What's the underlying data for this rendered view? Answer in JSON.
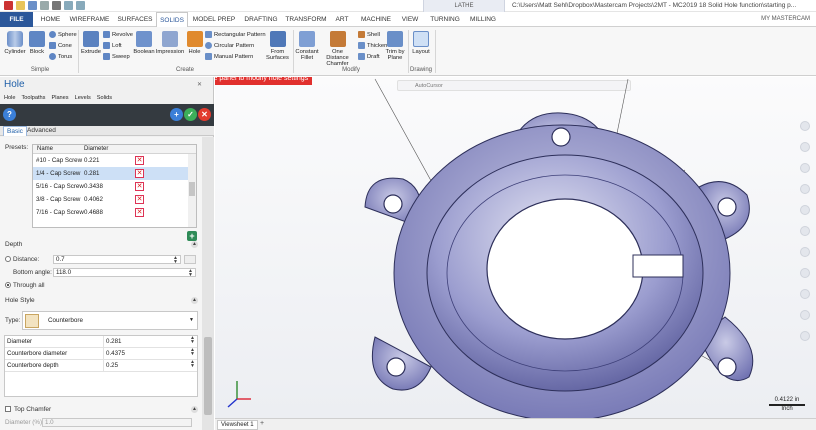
{
  "title_bar": {
    "context_group": "LATHE",
    "window_title": "C:\\Users\\Matt Sehl\\Dropbox\\Mastercam Projects\\2MT - MC2019 18 Solid Hole function\\starting p..."
  },
  "tabs": [
    "FILE",
    "HOME",
    "WIREFRAME",
    "SURFACES",
    "SOLIDS",
    "MODEL PREP",
    "DRAFTING",
    "TRANSFORM",
    "ART",
    "MACHINE",
    "VIEW",
    "TURNING",
    "MILLING"
  ],
  "active_tab": "SOLIDS",
  "user_link": "MY MASTERCAM",
  "ribbon": {
    "simple": {
      "cylinder": "Cylinder",
      "block": "Block",
      "sphere": "Sphere",
      "cone": "Cone",
      "torus": "Torus",
      "group": "Simple"
    },
    "create": {
      "extrude": "Extrude",
      "revolve": "Revolve",
      "loft": "Loft",
      "sweep": "Sweep",
      "boolean": "Boolean",
      "impression": "Impression",
      "hole": "Hole",
      "rect_pattern": "Rectangular Pattern",
      "circ_pattern": "Circular Pattern",
      "manual_pattern": "Manual Pattern",
      "from_surfaces_1": "From",
      "from_surfaces_2": "Surfaces",
      "group": "Create"
    },
    "modify": {
      "fillet_1": "Constant",
      "fillet_2": "Fillet",
      "chamfer_1": "One Distance",
      "chamfer_2": "Chamfer",
      "shell": "Shell",
      "thicken": "Thicken",
      "draft": "Draft",
      "trim_1": "Trim by",
      "trim_2": "Plane",
      "group": "Modify"
    },
    "drawing": {
      "layout": "Layout",
      "group": "Drawing"
    }
  },
  "panel": {
    "title": "Hole",
    "tabs": [
      "Hole",
      "Toolpaths",
      "Planes",
      "Levels",
      "Solids"
    ],
    "subtabs": {
      "basic": "Basic",
      "advanced": "Advanced"
    },
    "presets_label": "Presets:",
    "presets_columns": {
      "name": "Name",
      "diameter": "Diameter"
    },
    "presets": [
      {
        "name": "#10 - Cap Screw",
        "diameter": "0.221"
      },
      {
        "name": "1/4 - Cap Screw",
        "diameter": "0.281"
      },
      {
        "name": "5/16 - Cap Screw",
        "diameter": "0.3438"
      },
      {
        "name": "3/8 - Cap Screw",
        "diameter": "0.4062"
      },
      {
        "name": "7/16 - Cap Screw",
        "diameter": "0.4688"
      }
    ],
    "selected_preset": 1,
    "depth": {
      "heading": "Depth",
      "distance_label": "Distance:",
      "distance_value": "0.7",
      "bottom_angle_label": "Bottom angle:",
      "bottom_angle_value": "118.0",
      "through_all_label": "Through all",
      "through_all_selected": true
    },
    "hole_style": {
      "heading": "Hole Style",
      "type_label": "Type:",
      "type_value": "Counterbore",
      "params": [
        {
          "name": "Diameter",
          "value": "0.281"
        },
        {
          "name": "Counterbore diameter",
          "value": "0.4375"
        },
        {
          "name": "Counterbore depth",
          "value": "0.25"
        }
      ]
    },
    "top_chamfer": {
      "heading": "Top Chamfer",
      "diameter_label": "Diameter (%):",
      "diameter_value": "1.0"
    }
  },
  "viewport": {
    "tooltip": "Use panel to modify hole settings",
    "autocursor": "AutoCursor",
    "scale_value": "0.4122 in",
    "scale_unit": "Inch"
  },
  "status_bar": {
    "viewsheet": "Viewsheet 1"
  }
}
